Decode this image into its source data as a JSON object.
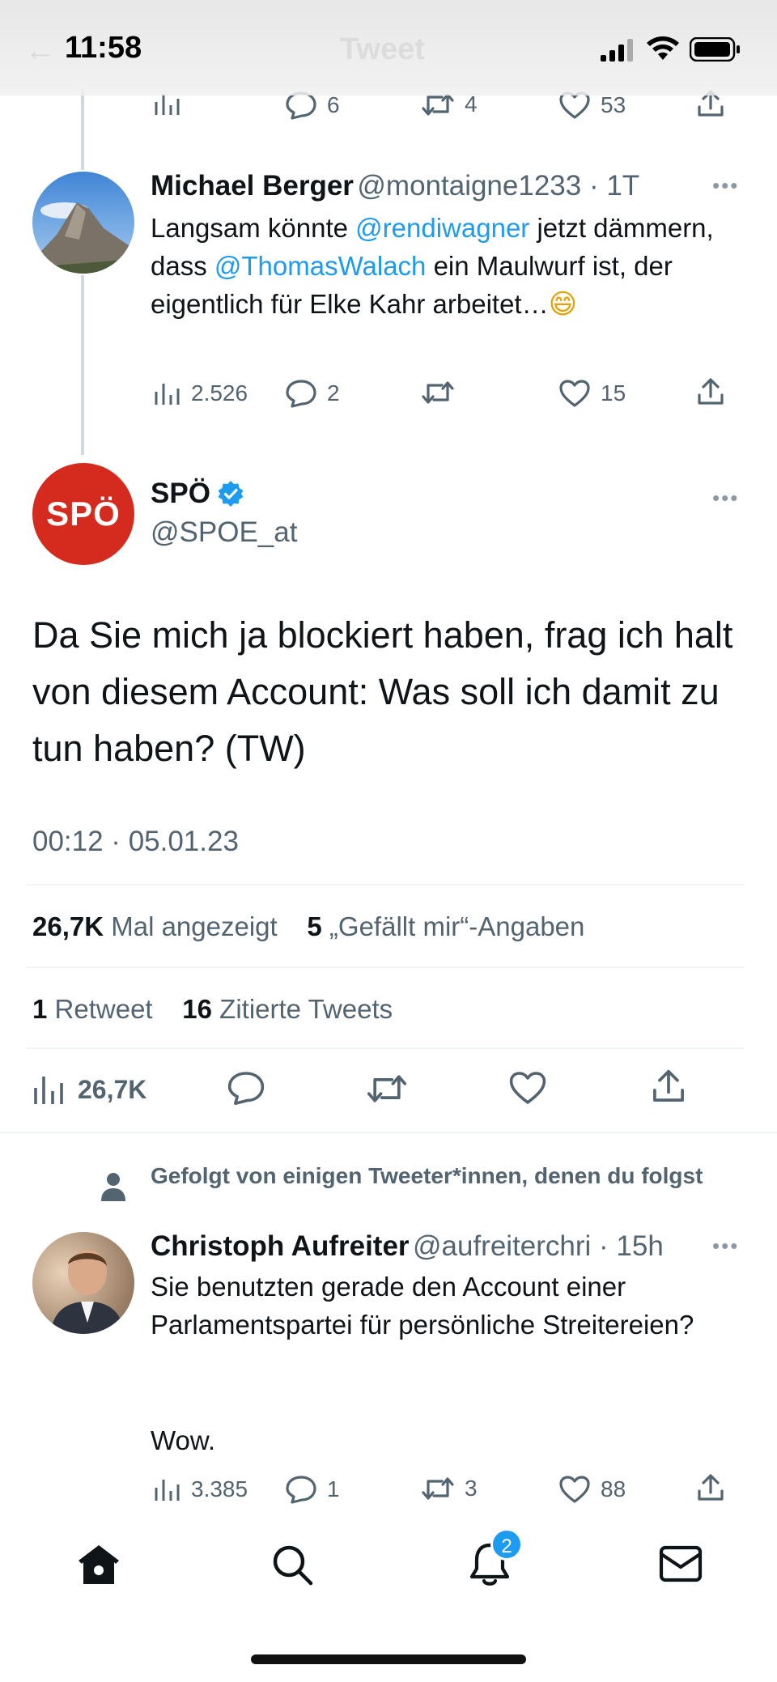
{
  "status_bar": {
    "time": "11:58",
    "screen_title": "Tweet"
  },
  "top_partial_tweet": {
    "replies": "6",
    "retweets": "4",
    "likes": "53"
  },
  "reply_tweet_1": {
    "name": "Michael Berger",
    "handle_time": "@montaigne1233 · 1T",
    "text_parts": [
      "Langsam könnte ",
      "@rendiwagner",
      " jetzt dämmern, dass ",
      "@ThomasWalach",
      " ein Maulwurf ist, der eigentlich für Elke Kahr arbeitet…",
      "😄"
    ],
    "views": "2.526",
    "replies": "2",
    "retweets": "",
    "likes": "15"
  },
  "main_tweet": {
    "avatar_text": "SPÖ",
    "name": "SPÖ",
    "handle": "@SPOE_at",
    "text": "Da Sie mich ja blockiert haben, frag ich halt von diesem Account: Was soll ich damit zu tun haben? (TW)",
    "timestamp": "00:12 · 05.01.23",
    "views_count": "26,7K",
    "views_label": "Mal angezeigt",
    "likes_count": "5",
    "likes_label": "„Gefällt mir“-Angaben",
    "retweets_count": "1",
    "retweets_label": "Retweet",
    "quotes_count": "16",
    "quotes_label": "Zitierte Tweets",
    "action_views": "26,7K"
  },
  "reply_tweet_2": {
    "social_context": "Gefolgt von einigen Tweeter*innen, denen du folgst",
    "name": "Christoph Aufreiter",
    "handle_time": "@aufreiterchri · 15h",
    "text_line1": "Sie benutzten gerade den Account einer Parlamentspartei für persönliche Streitereien?",
    "text_line2": "Wow.",
    "views": "3.385",
    "replies": "1",
    "retweets": "3",
    "likes": "88"
  },
  "tab_bar": {
    "notification_badge": "2"
  },
  "colors": {
    "accent": "#1d9bf0",
    "spoe_red": "#d52b1e",
    "text": "#0f1419",
    "secondary": "#536471"
  },
  "icons": [
    "analytics-icon",
    "reply-icon",
    "retweet-icon",
    "like-icon",
    "share-icon",
    "verified-badge-icon",
    "person-icon",
    "home-icon",
    "search-icon",
    "bell-icon",
    "mail-icon",
    "more-icon"
  ]
}
